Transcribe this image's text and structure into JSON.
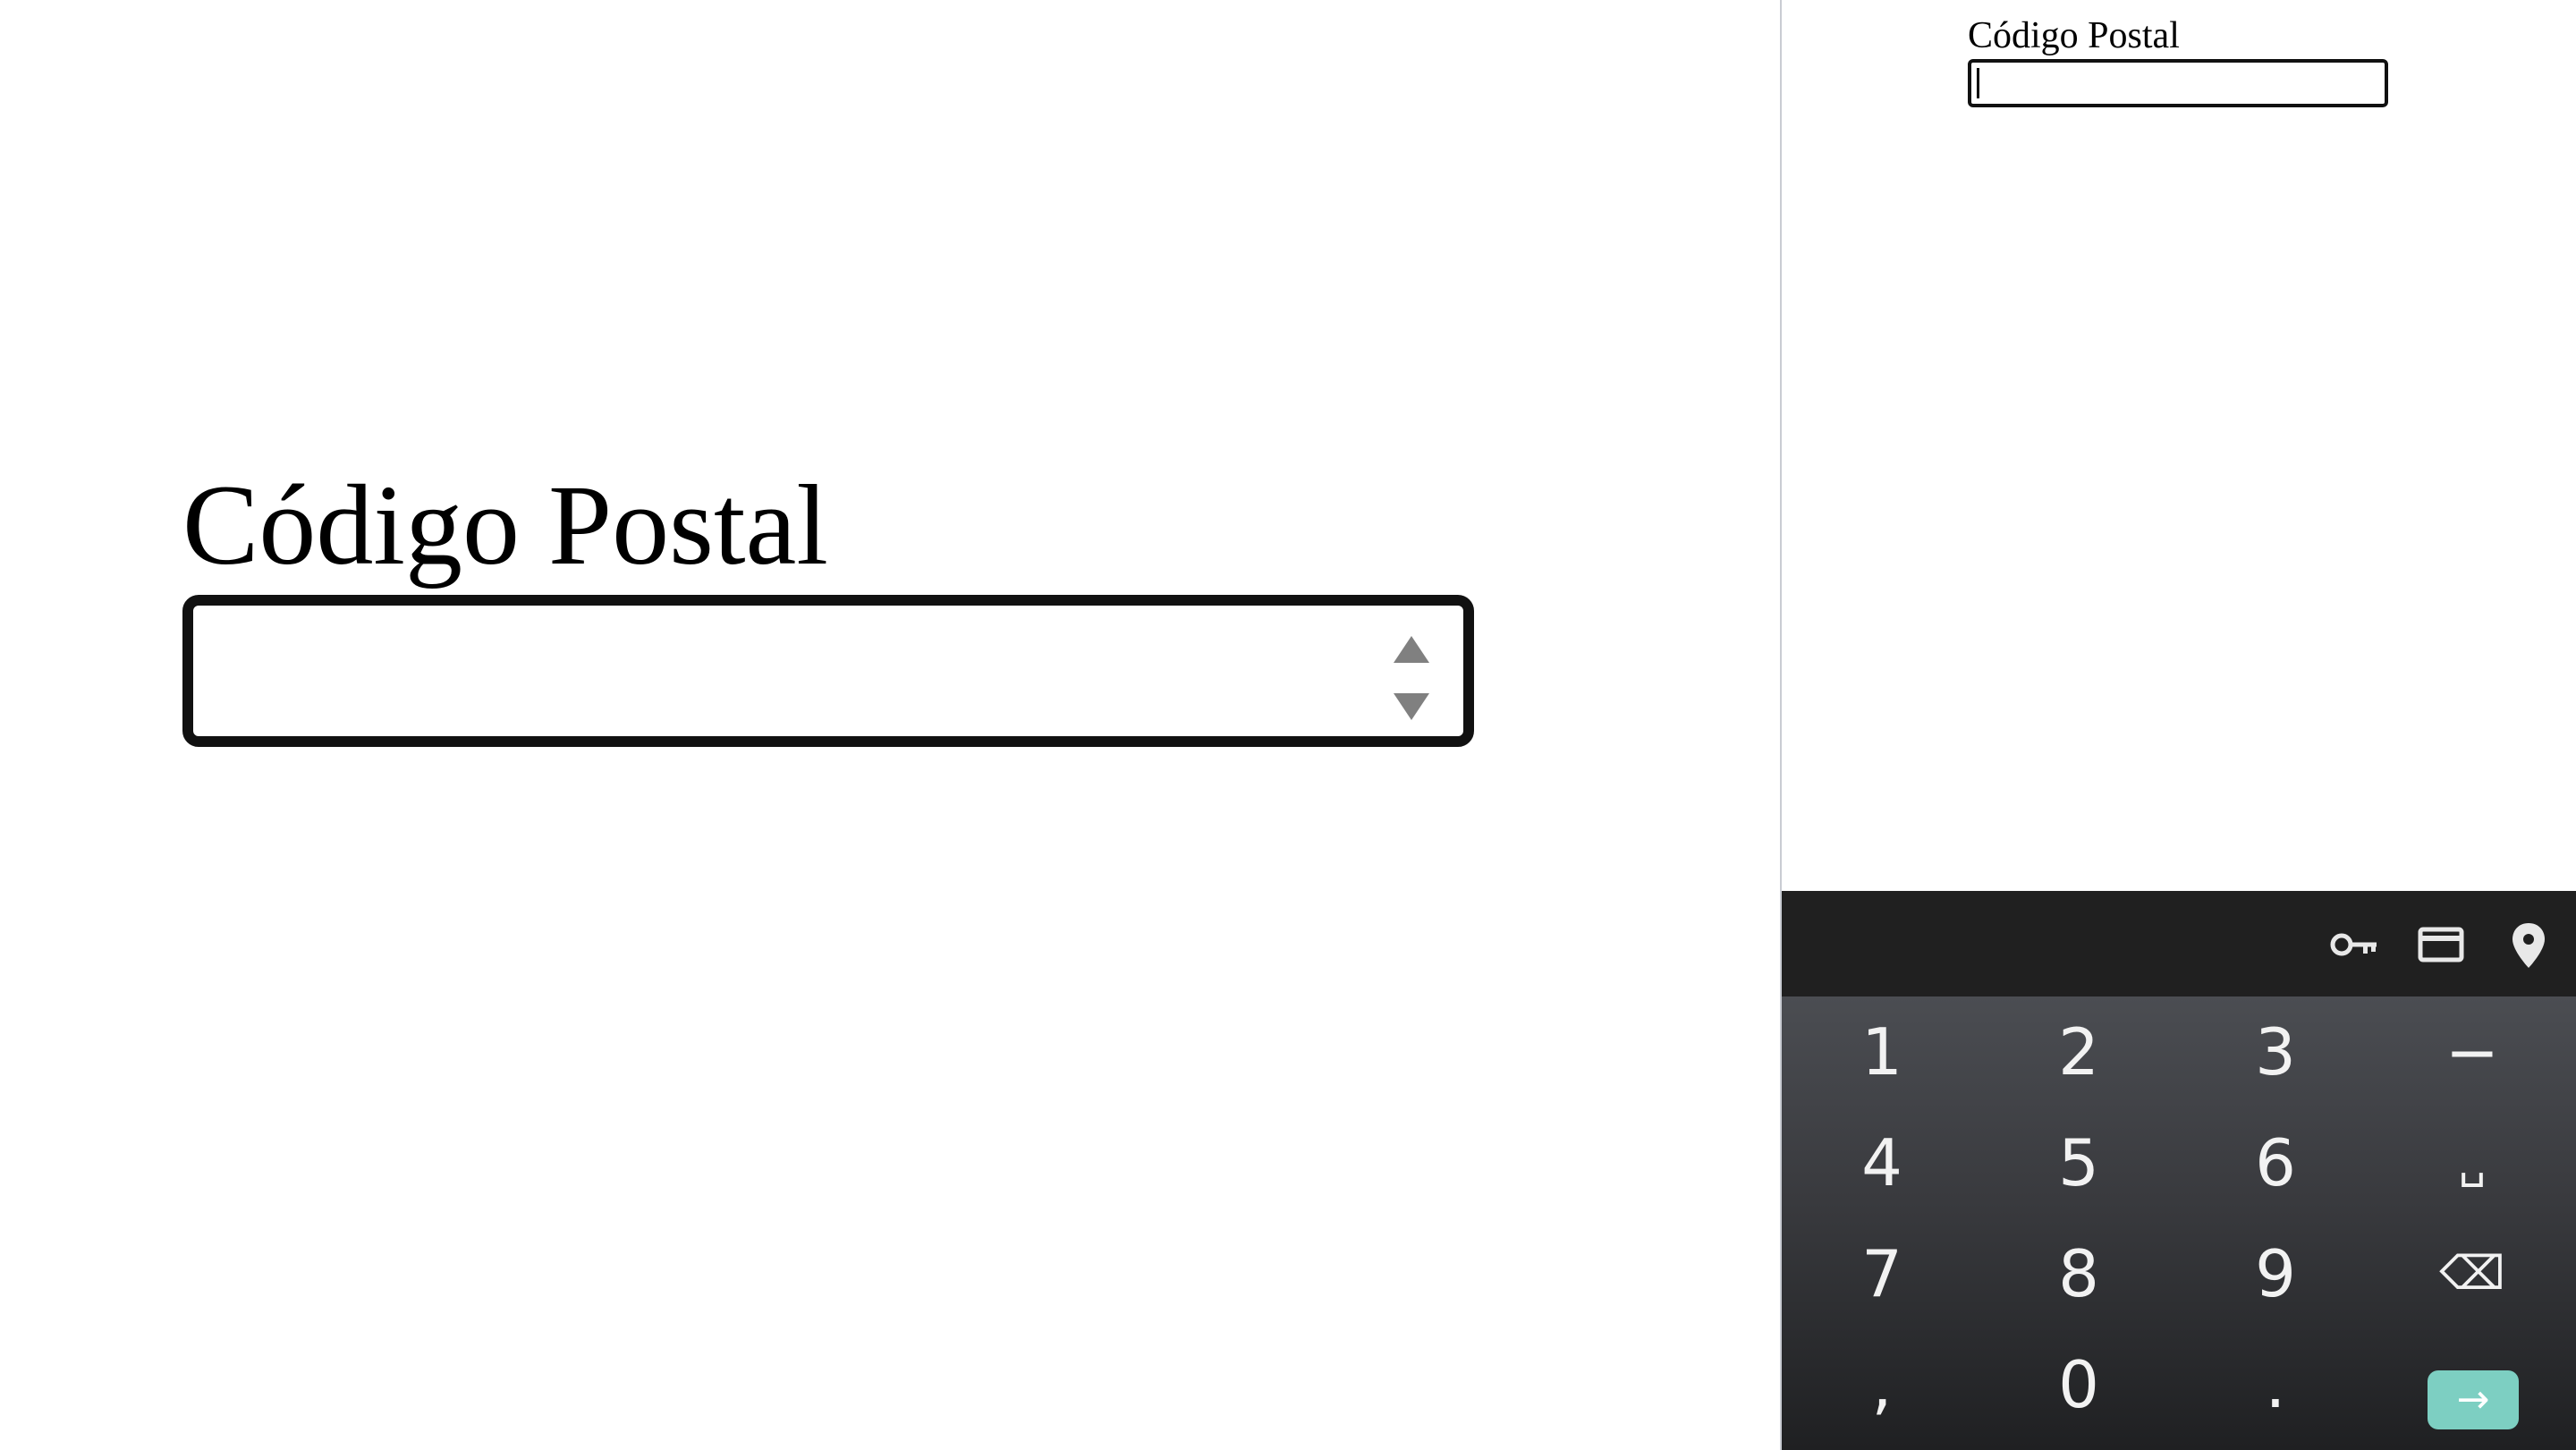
{
  "zoom": {
    "label": "Código Postal",
    "input_value": ""
  },
  "device": {
    "label": "Código Postal",
    "input_value": ""
  },
  "keyboard": {
    "toolbar_icons": [
      "key-icon",
      "credit-card-icon",
      "location-pin-icon"
    ],
    "rows": [
      [
        "1",
        "2",
        "3",
        "−"
      ],
      [
        "4",
        "5",
        "6",
        "␣"
      ],
      [
        "7",
        "8",
        "9",
        "⌫"
      ],
      [
        ",",
        "0",
        ".",
        "→"
      ]
    ],
    "enter_color": "#7dcfc2"
  }
}
